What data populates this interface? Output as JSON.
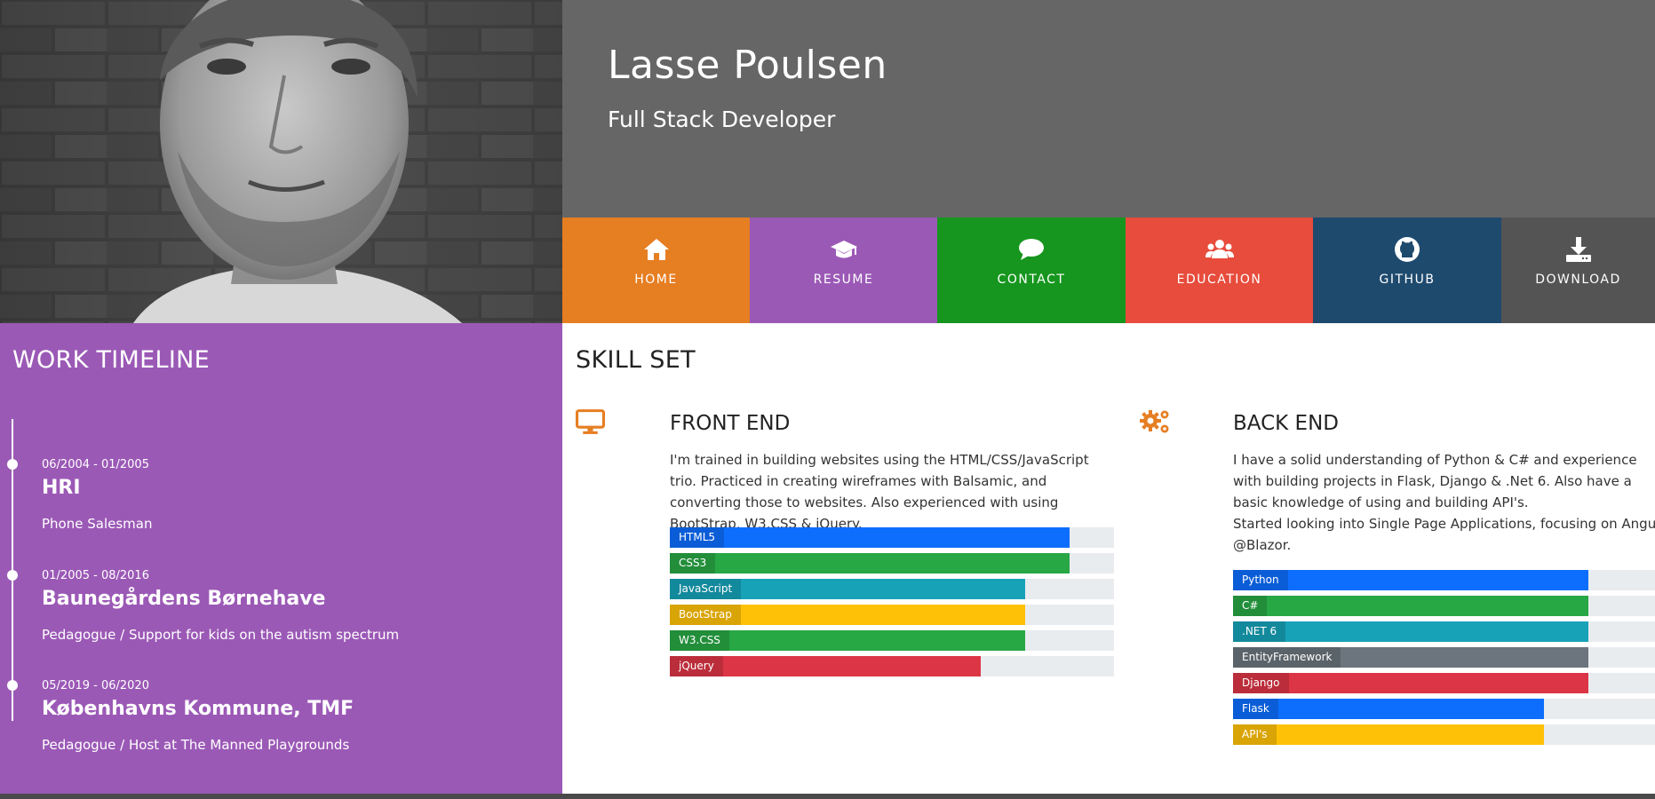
{
  "header": {
    "name": "Lasse Poulsen",
    "role": "Full Stack Developer"
  },
  "nav": [
    {
      "label": "HOME",
      "icon": "home-icon",
      "color": "#e67e22"
    },
    {
      "label": "RESUME",
      "icon": "graduation-cap-icon",
      "color": "#9b59b6"
    },
    {
      "label": "CONTACT",
      "icon": "chat-icon",
      "color": "#16961e"
    },
    {
      "label": "EDUCATION",
      "icon": "users-icon",
      "color": "#e74c3c"
    },
    {
      "label": "GITHUB",
      "icon": "github-icon",
      "color": "#1e4a6e"
    },
    {
      "label": "DOWNLOAD",
      "icon": "download-icon",
      "color": "#545454"
    }
  ],
  "timeline": {
    "title": "WORK TIMELINE",
    "items": [
      {
        "date": "06/2004 - 01/2005",
        "title": "HRI",
        "desc": "Phone Salesman"
      },
      {
        "date": "01/2005 - 08/2016",
        "title": "Baunegårdens Børnehave",
        "desc": "Pedagogue / Support for kids on the autism spectrum"
      },
      {
        "date": "05/2019 - 06/2020",
        "title": "Københavns Kommune, TMF",
        "desc": "Pedagogue / Host at The Manned Playgrounds"
      }
    ]
  },
  "skills": {
    "title": "SKILL SET",
    "frontend": {
      "title": "FRONT END",
      "icon": "monitor-icon",
      "text": "I'm trained in building websites using the HTML/CSS/JavaScript trio. Practiced in creating wireframes with Balsamic, and converting those to websites. Also experienced with using BootStrap, W3.CSS & jQuery.",
      "bars": [
        {
          "label": "HTML5",
          "percent": 90,
          "color": "#0d6efd"
        },
        {
          "label": "CSS3",
          "percent": 90,
          "color": "#28a745"
        },
        {
          "label": "JavaScript",
          "percent": 80,
          "color": "#17a2b8"
        },
        {
          "label": "BootStrap",
          "percent": 80,
          "color": "#ffc107"
        },
        {
          "label": "W3.CSS",
          "percent": 80,
          "color": "#28a745"
        },
        {
          "label": "jQuery",
          "percent": 70,
          "color": "#dc3545"
        }
      ]
    },
    "backend": {
      "title": "BACK END",
      "icon": "gears-icon",
      "text": "I have a solid understanding of Python & C# and experience with building projects in Flask, Django & .Net 6. Also have a basic knowledge of using and building API's.",
      "text2": "Started looking into Single Page Applications, focusing on Angular &",
      "text3": "@Blazor.",
      "bars": [
        {
          "label": "Python",
          "percent": 80,
          "color": "#0d6efd"
        },
        {
          "label": "C#",
          "percent": 80,
          "color": "#28a745"
        },
        {
          "label": ".NET 6",
          "percent": 80,
          "color": "#17a2b8"
        },
        {
          "label": "EntityFramework",
          "percent": 80,
          "color": "#6c757d"
        },
        {
          "label": "Django",
          "percent": 80,
          "color": "#dc3545"
        },
        {
          "label": "Flask",
          "percent": 70,
          "color": "#0d6efd"
        },
        {
          "label": "API's",
          "percent": 70,
          "color": "#ffc107"
        }
      ]
    }
  },
  "colors": {
    "timeline_bg": "#9b59b6",
    "header_bg": "#666666"
  }
}
